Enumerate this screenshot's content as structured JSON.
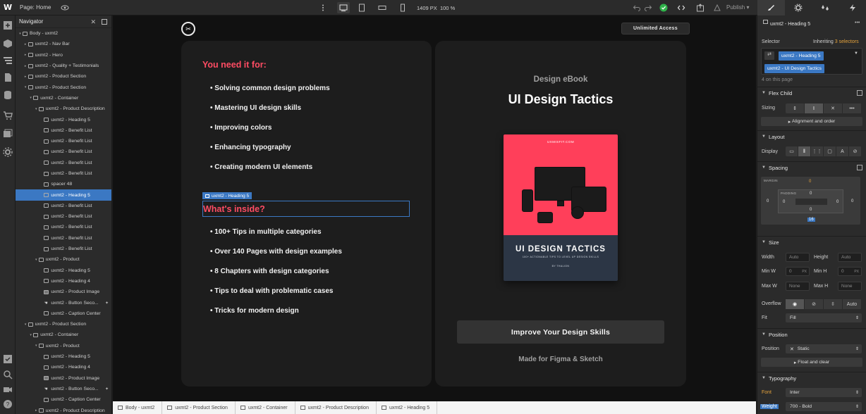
{
  "topbar": {
    "page_label": "Page: Home",
    "width_value": "1409",
    "width_unit": "PX",
    "zoom": "100 %",
    "publish_label": "Publish"
  },
  "navigator": {
    "title": "Navigator",
    "items": [
      {
        "label": "Body - uxmt2"
      },
      {
        "label": "uxmt2 - Nav Bar"
      },
      {
        "label": "uxmt2 - Hero"
      },
      {
        "label": "uxmt2 - Quality + Testimonials"
      },
      {
        "label": "uxmt2 - Product Section"
      },
      {
        "label": "uxmt2 - Product Section"
      },
      {
        "label": "uxmt2 - Container"
      },
      {
        "label": "uxmt2 - Product Description"
      },
      {
        "label": "uxmt2 - Heading 5"
      },
      {
        "label": "uxmt2 - Benefit List"
      },
      {
        "label": "uxmt2 - Benefit List"
      },
      {
        "label": "uxmt2 - Benefit List"
      },
      {
        "label": "uxmt2 - Benefit List"
      },
      {
        "label": "uxmt2 - Benefit List"
      },
      {
        "label": "spacer 48"
      },
      {
        "label": "uxmt2 - Heading 5"
      },
      {
        "label": "uxmt2 - Benefit List"
      },
      {
        "label": "uxmt2 - Benefit List"
      },
      {
        "label": "uxmt2 - Benefit List"
      },
      {
        "label": "uxmt2 - Benefit List"
      },
      {
        "label": "uxmt2 - Benefit List"
      },
      {
        "label": "uxmt2 - Product"
      },
      {
        "label": "uxmt2 - Heading 5"
      },
      {
        "label": "uxmt2 - Heading 4"
      },
      {
        "label": "uxmt2 - Product Image"
      },
      {
        "label": "uxmt2 - Button Seco..."
      },
      {
        "label": "uxmt2 - Caption Center"
      },
      {
        "label": "uxmt2 - Product Section"
      },
      {
        "label": "uxmt2 - Container"
      },
      {
        "label": "uxmt2 - Product"
      },
      {
        "label": "uxmt2 - Heading 5"
      },
      {
        "label": "uxmt2 - Heading 4"
      },
      {
        "label": "uxmt2 - Product Image"
      },
      {
        "label": "uxmt2 - Button Seco..."
      },
      {
        "label": "uxmt2 - Caption Center"
      },
      {
        "label": "uxmt2 - Product Description"
      }
    ]
  },
  "canvas": {
    "unlimited_label": "Unlimited Access",
    "need_heading": "You need it for:",
    "need_items": [
      "• Solving common design problems",
      "• Mastering UI design skills",
      "• Improving colors",
      "• Enhancing typography",
      "• Creating modern UI elements"
    ],
    "selected_tag": "uxmt2 - Heading 5",
    "inside_heading": "What's inside?",
    "inside_items": [
      "• 100+ Tips in multiple categories",
      "• Over 140 Pages with design examples",
      "• 8 Chapters with design categories",
      "• Tips to deal with problematic cases",
      "• Tricks for modern design"
    ],
    "ebook_label": "Design eBook",
    "product_title": "UI Design Tactics",
    "book_brand": "UXMISFIT.COM",
    "book_title": "UI DESIGN TACTICS",
    "book_subtitle": "100+ ACTIONABLE TIPS TO LEVEL UP DESIGN SKILLS",
    "book_author": "BY THALION",
    "cta_label": "Improve Your Design Skills",
    "caption": "Made for Figma & Sketch"
  },
  "breadcrumbs": [
    "Body - uxmt2",
    "uxmt2 - Product Section",
    "uxmt2 - Container",
    "uxmt2 - Product Description",
    "uxmt2 - Heading 5"
  ],
  "style_panel": {
    "element_name": "uxmt2 - Heading 5",
    "selector_label": "Selector",
    "inheriting_prefix": "Inheriting",
    "inheriting_count": "3 selectors",
    "selector_chip_1": "uxmt2 - Heading 5",
    "selector_chip_2": "uxmt2 - UI Design Tactics",
    "on_page": "4 on this page",
    "flex_child_title": "Flex Child",
    "sizing_label": "Sizing",
    "align_order": "Alignment and order",
    "layout_title": "Layout",
    "display_label": "Display",
    "spacing_title": "Spacing",
    "margin_label": "MARGIN",
    "padding_label": "PADDING",
    "margin_top": "0",
    "margin_left": "0",
    "margin_right": "0",
    "margin_bottom": "16",
    "padding_top": "0",
    "padding_left": "0",
    "padding_right": "0",
    "padding_bottom": "0",
    "size_title": "Size",
    "width_label": "Width",
    "width_val": "Auto",
    "height_label": "Height",
    "height_val": "Auto",
    "minw_label": "Min W",
    "minw_val": "0",
    "minw_unit": "PX",
    "minh_label": "Min H",
    "minh_val": "0",
    "minh_unit": "PX",
    "maxw_label": "Max W",
    "maxw_val": "None",
    "maxh_label": "Max H",
    "maxh_val": "None",
    "overflow_label": "Overflow",
    "overflow_auto": "Auto",
    "fit_label": "Fit",
    "fit_val": "Fill",
    "position_title": "Position",
    "position_label": "Position",
    "position_val": "Static",
    "float_clear": "Float and clear",
    "typography_title": "Typography",
    "font_label": "Font",
    "font_val": "Inter",
    "weight_label": "Weight",
    "weight_val": "700 - Bold"
  },
  "colors": {
    "accent_blue": "#3b78c3",
    "heading_red": "#ff4c63",
    "book_red": "#ff3f5a",
    "publish_green": "#2fb34a"
  }
}
